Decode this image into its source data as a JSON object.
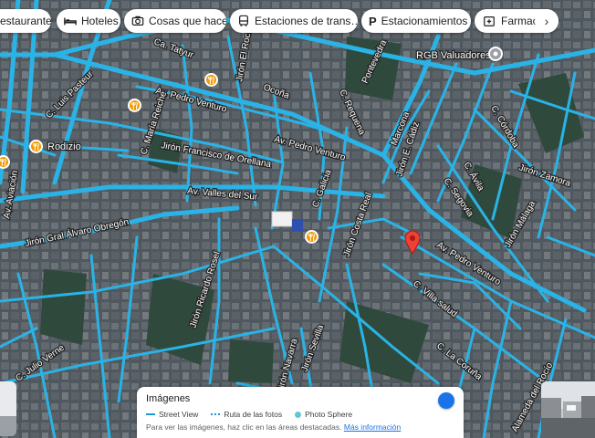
{
  "colors": {
    "street_view_line": "#2ab3e6",
    "accent_pin": "#ea4335",
    "place_pin": "#f29900",
    "link": "#1a73e8"
  },
  "filter_chips": [
    {
      "label": "estaurantes",
      "icon": "fork-knife-icon"
    },
    {
      "label": "Hoteles",
      "icon": "bed-icon"
    },
    {
      "label": "Cosas que hacer",
      "icon": "camera-icon"
    },
    {
      "label": "Estaciones de trans…",
      "icon": "bus-icon"
    },
    {
      "label": "Estacionamientos",
      "icon": "parking-icon"
    },
    {
      "label": "Farmacia",
      "icon": "pharmacy-icon"
    }
  ],
  "next_chip_icon": "chevron-right-icon",
  "streets": {
    "av_pedro_venturo_1": "Av. Pedro Venturo",
    "av_pedro_venturo_2": "Av. Pedro Venturo",
    "av_pedro_venturo_3": "Av. Pedro Venturo",
    "av_valles_del_sur": "Av. Valles del Sur",
    "jiron_alvaro_obregon": "Jirón Gral Álvaro Obregón",
    "jiron_francisco_orellana": "Jirón Francisco de Orellana",
    "jiron_el_rocio": "Jirón El Rocío",
    "c_tatyur": "Ca. Tatyur",
    "c_requena": "C. Requena",
    "c_pontevedra": "Pontevedra",
    "c_marcona": "Marcona",
    "c_zamora": "Jirón Zamora",
    "c_cordoba": "C. Córdoba",
    "c_avila": "C. Ávila",
    "c_segovia": "C. Segovia",
    "c_malaga": "Jirón Málaga",
    "c_galicia": "C. Galicia",
    "c_villa_salud": "C. Villa salud",
    "c_la_coruna": "C. La Coruña",
    "c_luis_pasteur": "C. Luis Pasteur",
    "c_maria_reiche": "C. María Reiche",
    "c_ricardo_rosel": "Jirón Ricardo Rosel",
    "c_julio_verne": "C. Julio Verne",
    "c_ocona": "Ocoña",
    "jiron_cadiz": "Jirón E. Cádiz",
    "jiron_costa_real": "Jirón Costa Real",
    "jiron_navarra": "Jirón Navarra",
    "jiron_sevilla": "Jirón Sevilla",
    "av_aviacion": "Av. Aviación",
    "alameda_rocio": "Alameda del Rocío"
  },
  "places": {
    "rgb_valuadores": "RGB Valuadores",
    "rodizio": "Rodizio"
  },
  "panel": {
    "title": "Imágenes",
    "legend": [
      {
        "label": "Street View",
        "swatch": "line"
      },
      {
        "label": "Ruta de las fotos",
        "swatch": "dash"
      },
      {
        "label": "Photo Sphere",
        "swatch": "dot"
      }
    ],
    "note": "Para ver las imágenes, haz clic en las áreas destacadas.",
    "link": "Más información"
  }
}
